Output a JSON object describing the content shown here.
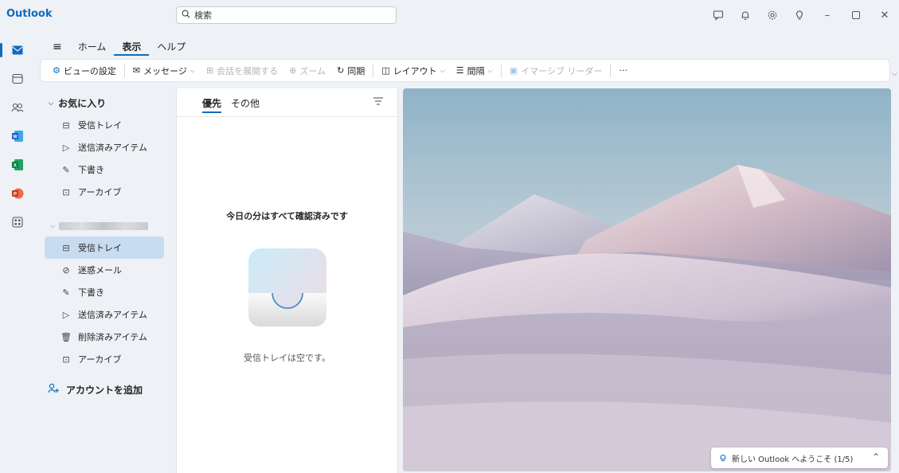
{
  "app": {
    "name": "Outlook"
  },
  "search": {
    "placeholder": "検索"
  },
  "ribbon": {
    "tabs": [
      {
        "label": "ホーム",
        "active": false
      },
      {
        "label": "表示",
        "active": true
      },
      {
        "label": "ヘルプ",
        "active": false
      }
    ],
    "toolbar": {
      "view_settings": "ビューの設定",
      "messages": "メッセージ",
      "expand_conversations": "会話を展開する",
      "zoom": "ズーム",
      "sync": "同期",
      "layout": "レイアウト",
      "spacing": "間隔",
      "immersive_reader": "イマーシブ リーダー",
      "more": "···"
    }
  },
  "folders": {
    "favorites_header": "お気に入り",
    "favorites": [
      {
        "label": "受信トレイ",
        "icon": "inbox-icon"
      },
      {
        "label": "送信済みアイテム",
        "icon": "send-icon"
      },
      {
        "label": "下書き",
        "icon": "draft-icon"
      },
      {
        "label": "アーカイブ",
        "icon": "archive-icon"
      }
    ],
    "account": [
      {
        "label": "受信トレイ",
        "icon": "inbox-icon",
        "selected": true
      },
      {
        "label": "迷惑メール",
        "icon": "junk-icon"
      },
      {
        "label": "下書き",
        "icon": "draft-icon"
      },
      {
        "label": "送信済みアイテム",
        "icon": "send-icon"
      },
      {
        "label": "削除済みアイテム",
        "icon": "trash-icon"
      },
      {
        "label": "アーカイブ",
        "icon": "archive-icon"
      }
    ],
    "add_account": "アカウントを追加"
  },
  "message_list": {
    "tabs": [
      {
        "label": "優先",
        "active": true
      },
      {
        "label": "その他",
        "active": false
      }
    ],
    "empty_title": "今日の分はすべて確認済みです",
    "empty_subtitle": "受信トレイは空です。"
  },
  "reading_pane": {
    "welcome": "新しい Outlook へようこそ (1/5)"
  },
  "colors": {
    "accent": "#0f6cbd",
    "selected": "#c7dcf0"
  }
}
